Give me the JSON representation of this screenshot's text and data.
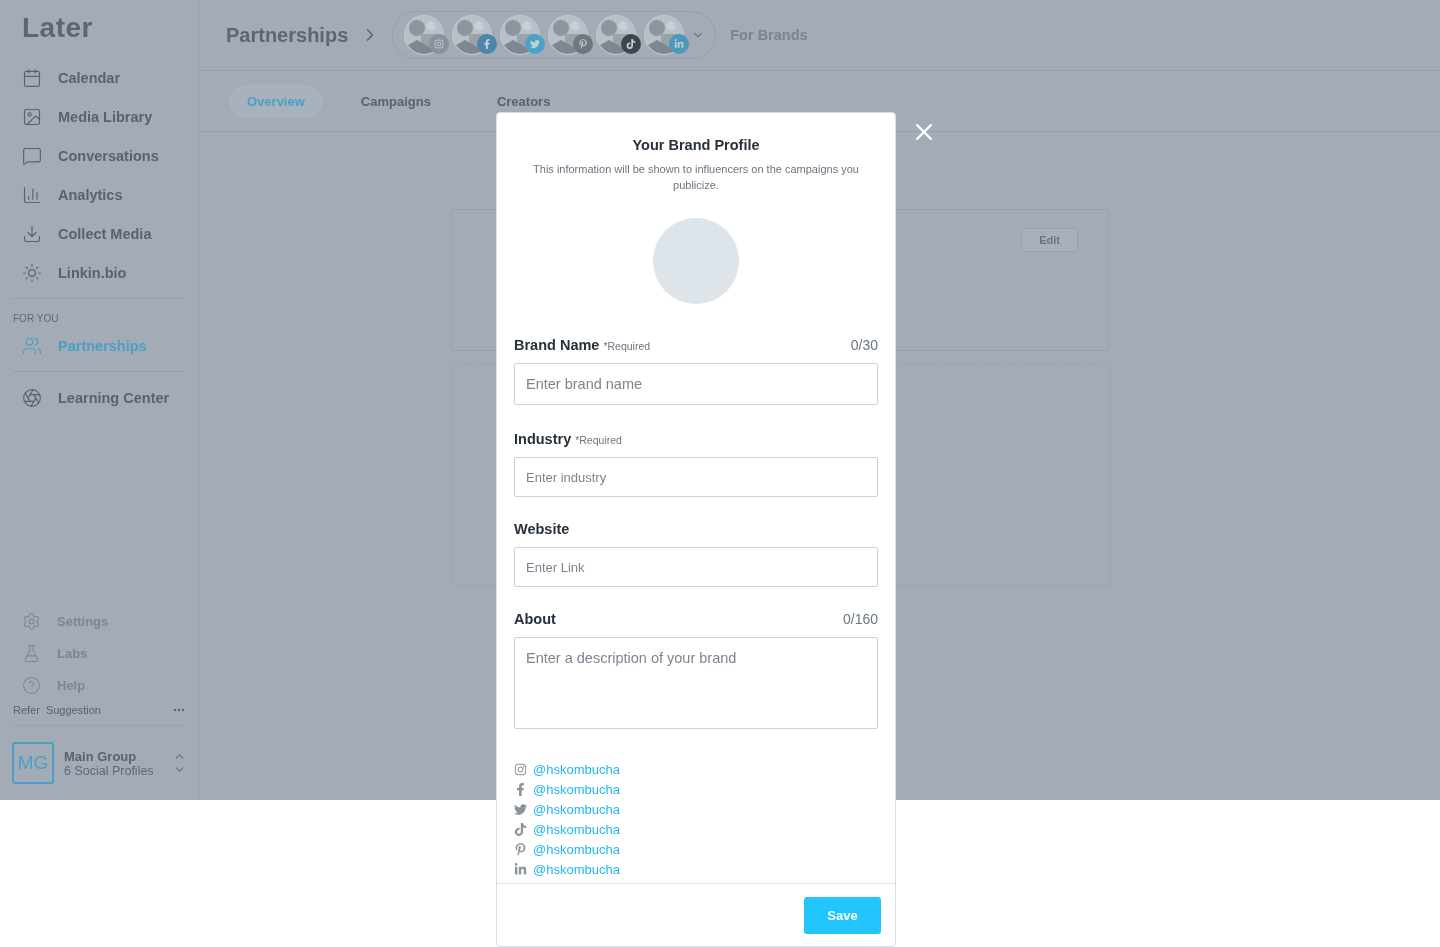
{
  "logo": "Later",
  "sidebar": {
    "items": [
      {
        "label": "Calendar",
        "selected": false
      },
      {
        "label": "Media Library",
        "selected": false
      },
      {
        "label": "Conversations",
        "selected": false
      },
      {
        "label": "Analytics",
        "selected": false
      },
      {
        "label": "Collect Media",
        "selected": false
      },
      {
        "label": "Linkin.bio",
        "selected": false
      }
    ],
    "section_label": "FOR YOU",
    "section_items": [
      {
        "label": "Partnerships",
        "selected": true
      }
    ],
    "extra_items": [
      {
        "label": "Learning Center",
        "selected": false
      }
    ],
    "bottom_items": [
      {
        "label": "Settings"
      },
      {
        "label": "Labs"
      },
      {
        "label": "Help"
      }
    ],
    "footer_links": [
      "Refer",
      "Suggestion"
    ],
    "account": {
      "initials": "MG",
      "name": "Main Group",
      "subtitle": "6 Social Profiles"
    }
  },
  "header": {
    "title": "Partnerships",
    "profiles": [
      {
        "kind": "instagram"
      },
      {
        "kind": "facebook"
      },
      {
        "kind": "twitter"
      },
      {
        "kind": "pinterest"
      },
      {
        "kind": "tiktok"
      },
      {
        "kind": "linkedin"
      }
    ],
    "context": "For Brands"
  },
  "tabs": [
    {
      "label": "Overview",
      "selected": true
    },
    {
      "label": "Campaigns",
      "selected": false
    },
    {
      "label": "Creators",
      "selected": false
    }
  ],
  "card": {
    "button": "Edit"
  },
  "modal": {
    "title": "Your Brand Profile",
    "subtitle": "This information will be shown to influencers on the campaigns you publicize.",
    "fields": [
      {
        "kind": "input",
        "label": "Brand Name",
        "required": "*Required",
        "counter": "0/30",
        "placeholder": "Enter brand name"
      },
      {
        "kind": "input",
        "label": "Industry",
        "required": "*Required",
        "placeholder": "Enter industry"
      },
      {
        "kind": "input",
        "label": "Website",
        "placeholder": "Enter Link"
      },
      {
        "kind": "textarea",
        "label": "About",
        "counter": "0/160",
        "placeholder": "Enter a description of your brand"
      }
    ],
    "socials": [
      {
        "kind": "instagram",
        "handle": "@hskombucha"
      },
      {
        "kind": "facebook",
        "handle": "@hskombucha"
      },
      {
        "kind": "twitter",
        "handle": "@hskombucha"
      },
      {
        "kind": "tiktok",
        "handle": "@hskombucha"
      },
      {
        "kind": "pinterest",
        "handle": "@hskombucha"
      },
      {
        "kind": "linkedin",
        "handle": "@hskombucha"
      }
    ],
    "save": "Save"
  }
}
